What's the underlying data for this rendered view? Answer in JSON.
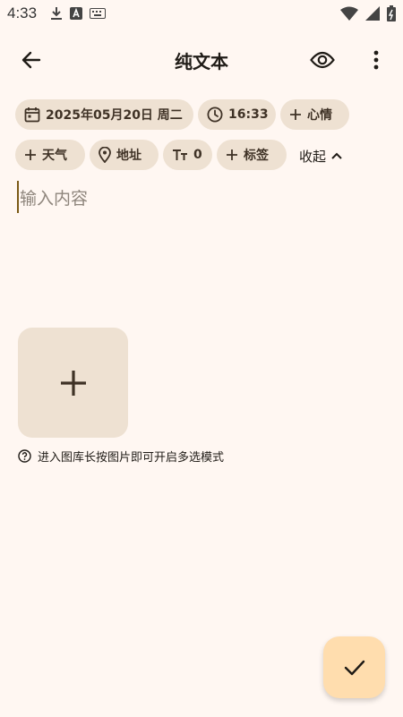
{
  "status_bar": {
    "time": "4:33",
    "left_icons": [
      "download-icon",
      "a-letter-icon",
      "keyboard-icon"
    ],
    "right_icons": [
      "wifi-icon",
      "signal-icon",
      "battery-icon"
    ]
  },
  "appbar": {
    "title": "纯文本",
    "back_icon": "arrow-left-icon",
    "preview_icon": "eye-icon",
    "more_icon": "more-vert-icon"
  },
  "chips": {
    "date": "2025年05月20日 周二",
    "time": "16:33",
    "mood": "心情",
    "weather": "天气",
    "location": "地址",
    "font_size": "0",
    "tag": "标签"
  },
  "collapse_label": "收起",
  "editor": {
    "placeholder": "输入内容"
  },
  "hint": "进入图库长按图片即可开启多选模式",
  "colors": {
    "background": "#FFF7F2",
    "chip": "#EEE1D2",
    "fab": "#FFDDAE",
    "cursor": "#7B5A16"
  }
}
